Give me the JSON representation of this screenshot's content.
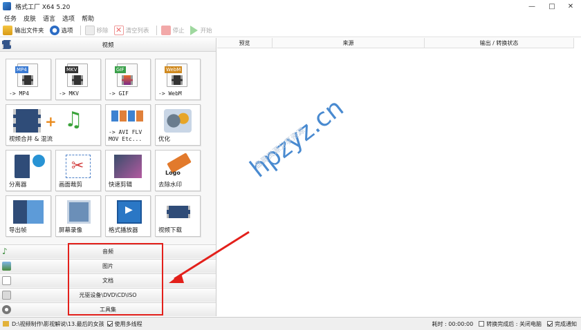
{
  "window": {
    "title": "格式工厂 X64 5.20",
    "minimize": "—",
    "maximize": "□",
    "close": "✕"
  },
  "menu": [
    "任务",
    "皮肤",
    "语言",
    "选项",
    "帮助"
  ],
  "toolbar": {
    "output_folder": "输出文件夹",
    "options": "选项",
    "remove": "移除",
    "clear_list": "清空列表",
    "stop": "停止",
    "start": "开始"
  },
  "left": {
    "video_header": "视频",
    "tiles": [
      {
        "badge": "MP4",
        "label": "-> MP4",
        "color": "#3b7bd3"
      },
      {
        "badge": "MKV",
        "label": "-> MKV",
        "color": "#333333"
      },
      {
        "badge": "GIF",
        "label": "-> GIF",
        "color": "#3aa04a"
      },
      {
        "badge": "WebM",
        "label": "-> WebM",
        "color": "#d08a20"
      },
      {
        "label": "视频合并 & 混流"
      },
      {
        "label": "-> AVI FLV\nMOV Etc..."
      },
      {
        "label": "优化"
      },
      {
        "label": "分离器"
      },
      {
        "label": "画面裁剪"
      },
      {
        "label": "快速剪辑"
      },
      {
        "label": "去除水印"
      },
      {
        "label": "导出帧"
      },
      {
        "label": "屏幕录像"
      },
      {
        "label": "格式播放器"
      },
      {
        "label": "视频下载"
      }
    ],
    "categories": [
      "音频",
      "图片",
      "文档",
      "光驱设备\\DVD\\CD\\ISO",
      "工具集"
    ]
  },
  "table": {
    "columns": [
      "预览",
      "来源",
      "输出 / 转换状态"
    ]
  },
  "status": {
    "path": "D:\\视频制作\\影视解说\\13.最后的女孩",
    "multithread": "使用多线程",
    "elapsed": "耗时 : 00:00:00",
    "after_convert": "转换完成后 : 关闭电脑",
    "notify": "完成通知"
  },
  "watermark": {
    "site": "hpzyz.cn",
    "sub": "盘哥资源分享资源"
  },
  "colors": {
    "accent_red": "#e3201b",
    "link_blue": "#2a76c8"
  }
}
